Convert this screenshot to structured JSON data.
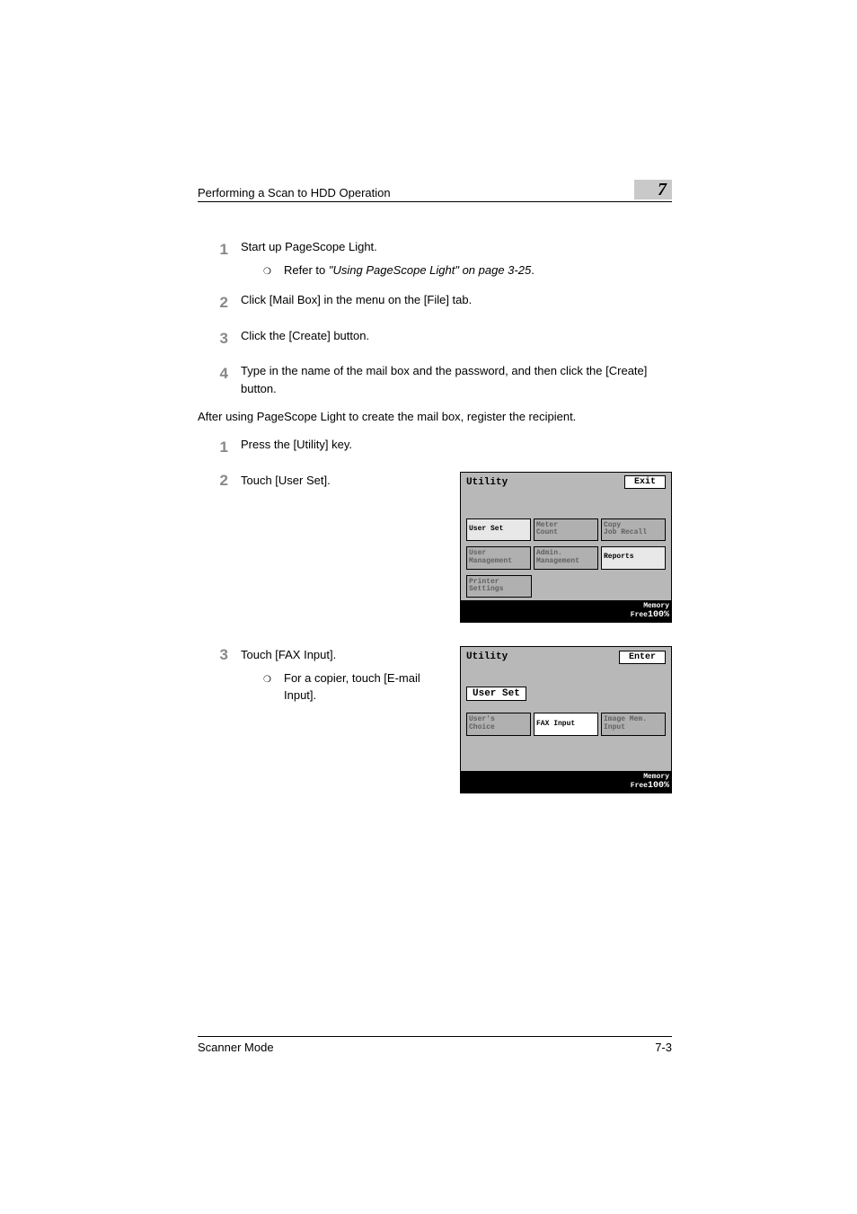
{
  "header": {
    "title": "Performing a Scan to HDD Operation",
    "chapter": "7"
  },
  "stepsA": [
    {
      "n": "1",
      "t": "Start up PageScope Light.",
      "sub": {
        "pre": "Refer to ",
        "italic": "\"Using PageScope Light\" on page 3-25",
        "post": "."
      }
    },
    {
      "n": "2",
      "t": "Click [Mail Box] in the menu on the [File] tab."
    },
    {
      "n": "3",
      "t": "Click the [Create] button."
    },
    {
      "n": "4",
      "t": "Type in the name of the mail box and the password, and then click the [Create] button."
    }
  ],
  "para1": "After using PageScope Light to create the mail box, register the recipient.",
  "stepB1": {
    "n": "1",
    "t": "Press the [Utility] key."
  },
  "stepB2": {
    "n": "2",
    "t": "Touch [User Set]."
  },
  "stepB3": {
    "n": "3",
    "t": "Touch [FAX Input].",
    "sub": "For a copier, touch [E-mail Input]."
  },
  "panel1": {
    "title": "Utility",
    "exit": "Exit",
    "row1": [
      {
        "l": "User Set",
        "c": "light"
      },
      {
        "l": "Meter\nCount",
        "c": "grey"
      },
      {
        "l": "Copy\nJob Recall",
        "c": "grey"
      }
    ],
    "row2": [
      {
        "l": "User\nManagement",
        "c": "grey"
      },
      {
        "l": "Admin.\nManagement",
        "c": "grey"
      },
      {
        "l": "Reports",
        "c": "light"
      }
    ],
    "row3": [
      {
        "l": "Printer\nSettings",
        "c": "grey"
      },
      {
        "l": "",
        "c": "empty"
      },
      {
        "l": "",
        "c": "empty"
      }
    ],
    "status": {
      "label": "Memory\nFree",
      "val": "100%"
    }
  },
  "panel2": {
    "title": "Utility",
    "exit": "Enter",
    "crumb": "User Set",
    "row1": [
      {
        "l": "User's\nChoice",
        "c": "grey"
      },
      {
        "l": "FAX Input",
        "c": "white"
      },
      {
        "l": "Image Mem.\nInput",
        "c": "grey"
      }
    ],
    "status": {
      "label": "Memory\nFree",
      "val": "100%"
    }
  },
  "footer": {
    "left": "Scanner Mode",
    "right": "7-3"
  }
}
